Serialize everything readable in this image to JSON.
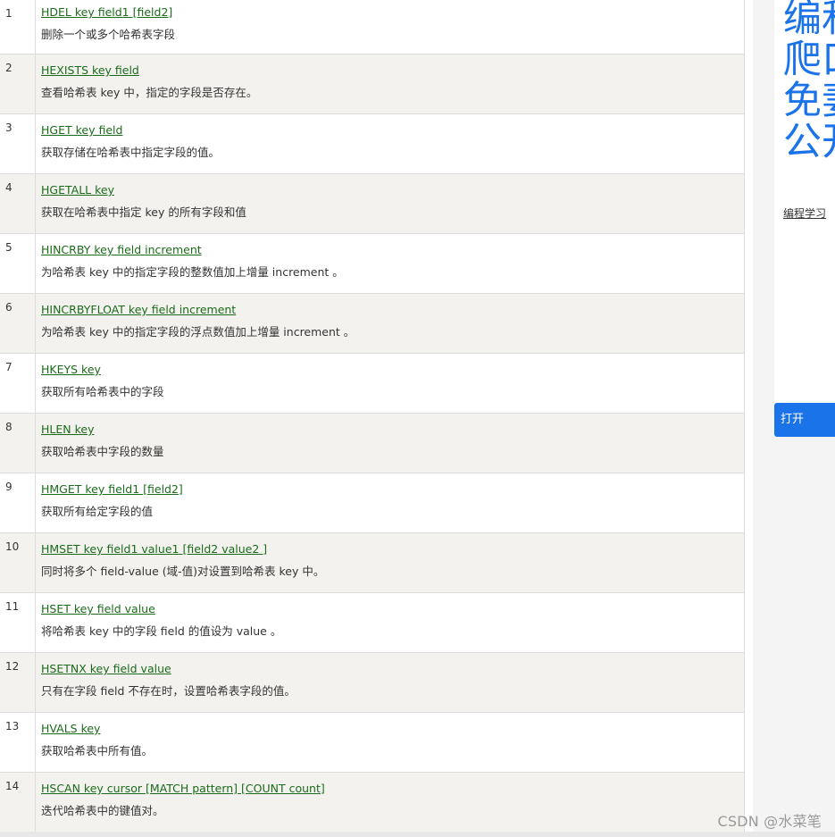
{
  "commands": [
    {
      "num": "1",
      "command": "HDEL key field1 [field2]",
      "desc": "删除一个或多个哈希表字段"
    },
    {
      "num": "2",
      "command": "HEXISTS key field",
      "desc": "查看哈希表 key 中，指定的字段是否存在。"
    },
    {
      "num": "3",
      "command": "HGET key field",
      "desc": "获取存储在哈希表中指定字段的值。"
    },
    {
      "num": "4",
      "command": "HGETALL key",
      "desc": "获取在哈希表中指定 key 的所有字段和值"
    },
    {
      "num": "5",
      "command": "HINCRBY key field increment",
      "desc": "为哈希表 key 中的指定字段的整数值加上增量 increment 。"
    },
    {
      "num": "6",
      "command": "HINCRBYFLOAT key field increment",
      "desc": "为哈希表 key 中的指定字段的浮点数值加上增量 increment 。"
    },
    {
      "num": "7",
      "command": "HKEYS key",
      "desc": "获取所有哈希表中的字段"
    },
    {
      "num": "8",
      "command": "HLEN key",
      "desc": "获取哈希表中字段的数量"
    },
    {
      "num": "9",
      "command": "HMGET key field1 [field2]",
      "desc": "获取所有给定字段的值"
    },
    {
      "num": "10",
      "command": "HMSET key field1 value1 [field2 value2 ]",
      "desc": "同时将多个 field-value (域-值)对设置到哈希表 key 中。"
    },
    {
      "num": "11",
      "command": "HSET key field value",
      "desc": "将哈希表 key 中的字段 field 的值设为 value 。"
    },
    {
      "num": "12",
      "command": "HSETNX key field value",
      "desc": "只有在字段 field 不存在时，设置哈希表字段的值。"
    },
    {
      "num": "13",
      "command": "HVALS key",
      "desc": "获取哈希表中所有值。"
    },
    {
      "num": "14",
      "command": "HSCAN key cursor [MATCH pattern] [COUNT count]",
      "desc": "迭代哈希表中的键值对。"
    }
  ],
  "ad": {
    "headline_lines": [
      "编和",
      "爬口",
      "免妻",
      "公开"
    ],
    "sub_label": "编程学习",
    "button_label": "打开"
  },
  "watermark": "CSDN @水菜笔",
  "colors": {
    "link": "#1a6b1a",
    "row_alt": "#f3f2ef",
    "ad_accent": "#1a73e8"
  }
}
